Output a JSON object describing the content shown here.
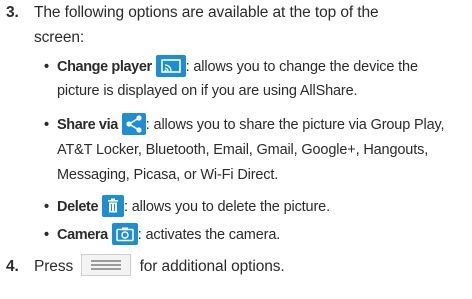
{
  "step3": {
    "number": "3.",
    "line1": "The following options are available at the top of the",
    "line2": "screen:"
  },
  "bullets": {
    "change_player": {
      "term": "Change player",
      "icon": "change-player-icon",
      "line1_rest": ": allows you to change the device the",
      "line2": "picture is displayed on if you are using AllShare."
    },
    "share_via": {
      "term": "Share via",
      "icon": "share-icon",
      "line1_rest": ": allows you to share the picture via Group Play,",
      "line2": "AT&T Locker, Bluetooth, Email, Gmail, Google+, Hangouts,",
      "line3": "Messaging, Picasa, or Wi-Fi Direct."
    },
    "delete": {
      "term": "Delete",
      "icon": "trash-icon",
      "rest": ": allows you to delete the picture."
    },
    "camera": {
      "term": "Camera",
      "icon": "camera-icon",
      "rest": ": activates the camera."
    }
  },
  "step4": {
    "number": "4.",
    "before": "Press",
    "icon": "menu-key-icon",
    "after": "for additional options."
  },
  "colors": {
    "icon_blue": "#1d8ed1",
    "text": "#2b2b2b"
  }
}
